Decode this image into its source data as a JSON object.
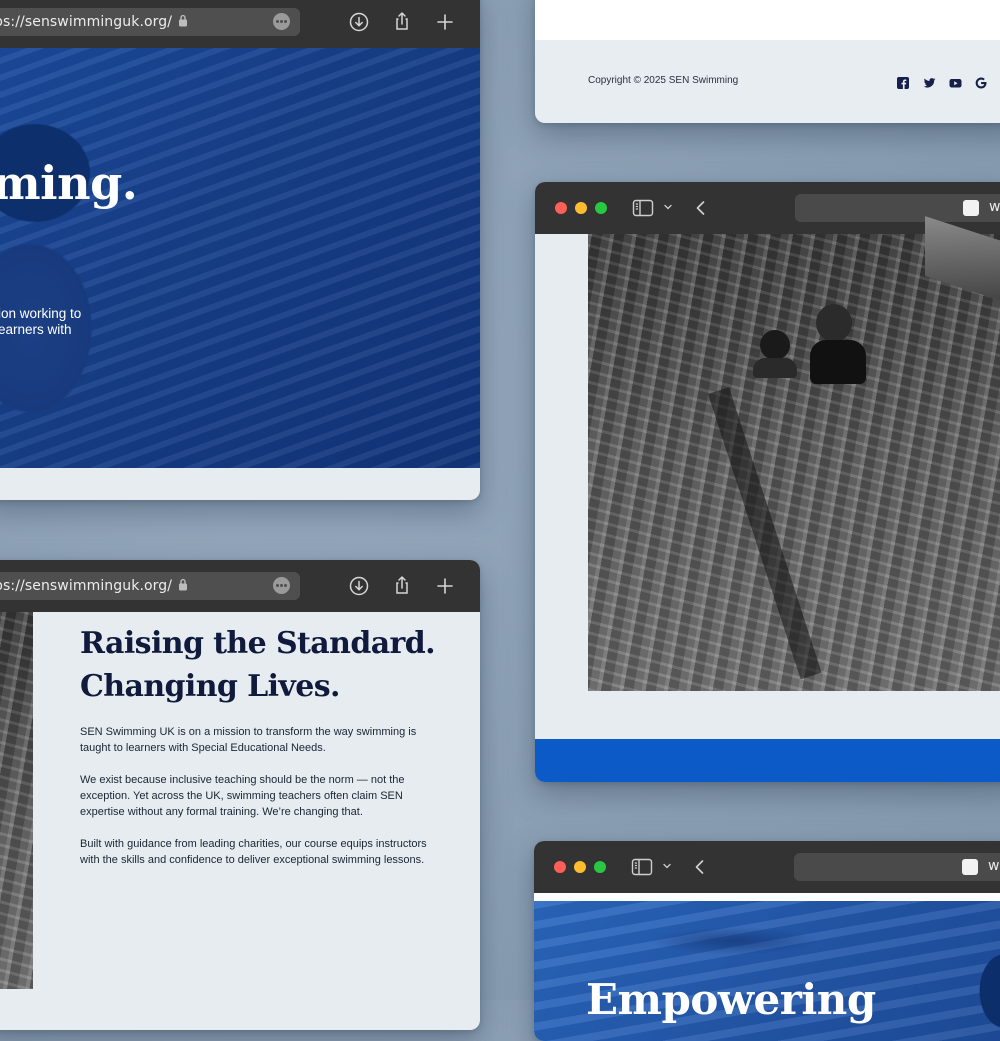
{
  "windows": {
    "hero_window": {
      "url": "ps://senswimminguk.org/",
      "hero_heading_fragment": "ming.",
      "hero_text_lines": [
        "ion working to",
        "earners with"
      ]
    },
    "footer_window": {
      "copyright": "Copyright © 2025 SEN Swimming",
      "social_icons": [
        "facebook-icon",
        "twitter-icon",
        "youtube-icon",
        "google-icon"
      ]
    },
    "photo_window": {
      "url_fragment": "w"
    },
    "about_window": {
      "url": "ps://senswimminguk.org/",
      "heading_line1": "Raising the Standard.",
      "heading_line2": "Changing Lives.",
      "paragraphs": [
        "SEN Swimming UK is on a mission to transform the way swimming is taught to learners with Special Educational Needs.",
        "We exist because inclusive teaching should be the norm — not the exception. Yet across the UK, swimming teachers often claim SEN expertise without any formal training. We’re changing that.",
        "Built with guidance from leading charities, our course equips instructors with the skills and confidence to deliver exceptional swimming lessons."
      ]
    },
    "bottom_window": {
      "url_fragment": "w",
      "hero_heading_fragment": "Empowering"
    }
  },
  "colors": {
    "toolbar": "#333333",
    "page_bg": "#e6ecf0",
    "heading_navy": "#0f1a3c",
    "accent_blue": "#0b5ac8",
    "traffic_red": "#fe5f57",
    "traffic_yellow": "#febc2e",
    "traffic_green": "#28c840"
  }
}
